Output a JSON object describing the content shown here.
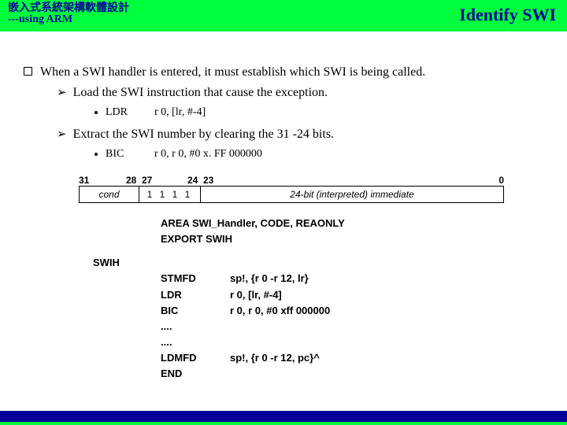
{
  "header": {
    "title_cn": "嵌入式系統架構軟體設計",
    "subtitle": "---using ARM",
    "right": "Identify SWI"
  },
  "main": {
    "bullet1": "When a SWI handler is entered, it must establish which SWI is being called.",
    "sub1": "Load the SWI instruction that cause the exception.",
    "code1_mn": "LDR",
    "code1_arg": "r 0, [lr, #-4]",
    "sub2": "Extract the SWI number by clearing the 31 -24 bits.",
    "code2_mn": "BIC",
    "code2_arg": "r 0, r 0, #0 x. FF 000000"
  },
  "encoding": {
    "bits": {
      "b31": "31",
      "b28": "28",
      "b27": "27",
      "b24": "24",
      "b23": "23",
      "b0": "0"
    },
    "cond": "cond",
    "opcode": "1 1 1 1",
    "imm": "24-bit (interpreted) immediate"
  },
  "asm": {
    "area": "AREA SWI_Handler, CODE, REAONLY",
    "export": "EXPORT SWIH",
    "label": "SWIH",
    "r1_mn": "STMFD",
    "r1_arg": "sp!, {r 0 -r 12, lr}",
    "r2_mn": "LDR",
    "r2_arg": "r 0, [lr, #-4]",
    "r3_mn": "BIC",
    "r3_arg": "r 0, r 0, #0 xff 000000",
    "dots1": "....",
    "dots2": "....",
    "r4_mn": "LDMFD",
    "r4_arg": "sp!, {r 0 -r 12, pc}^",
    "r5_mn": "END"
  }
}
